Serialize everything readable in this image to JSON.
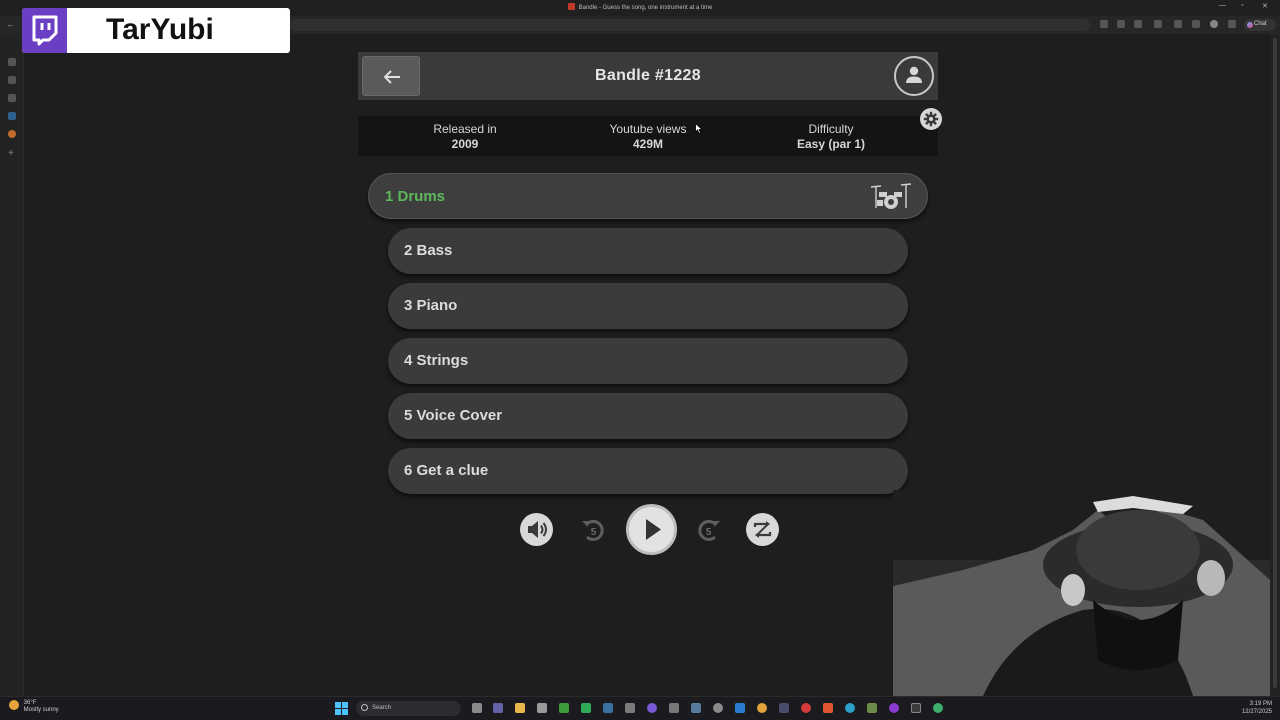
{
  "browser": {
    "window_title": "Bandle - Guess the song, one instrument at a time",
    "chat_label": "Chat"
  },
  "overlay": {
    "streamer_name": "TarYubi"
  },
  "game": {
    "title": "Bandle #1228",
    "info": {
      "released_label": "Released in",
      "released_value": "2009",
      "views_label": "Youtube views",
      "views_value": "429M",
      "difficulty_label": "Difficulty",
      "difficulty_value": "Easy (par 1)"
    },
    "tracks": [
      {
        "label": "1  Drums",
        "state": "active",
        "icon": "drum-kit-icon"
      },
      {
        "label": "2  Bass",
        "state": "locked"
      },
      {
        "label": "3  Piano",
        "state": "locked"
      },
      {
        "label": "4  Strings",
        "state": "locked"
      },
      {
        "label": "5  Voice Cover",
        "state": "locked"
      },
      {
        "label": "6  Get a clue",
        "state": "locked"
      }
    ],
    "controls": {
      "rewind_seconds": "5",
      "forward_seconds": "5"
    },
    "colors": {
      "active_track": "#5cb85c",
      "track_bg": "#3b3b3b",
      "page_bg": "#1e1e1e"
    }
  },
  "taskbar": {
    "temperature": "36°F",
    "weather": "Mostly sunny",
    "search_placeholder": "Search",
    "time": "3:19 PM",
    "date": "12/27/2025"
  }
}
